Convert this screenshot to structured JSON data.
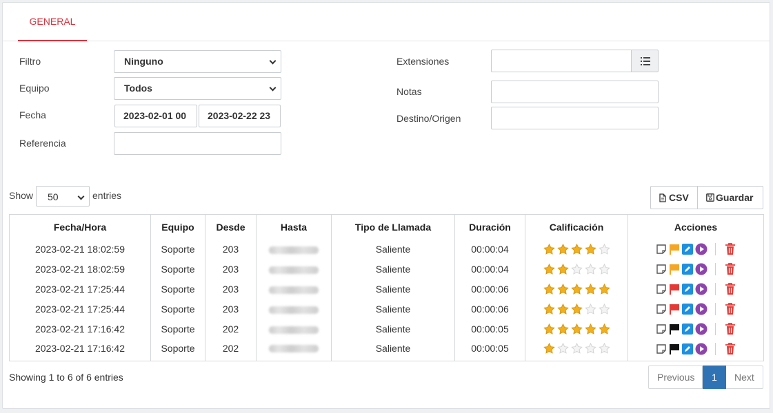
{
  "tabs": {
    "general": "GENERAL"
  },
  "filters": {
    "filtro_label": "Filtro",
    "filtro_value": "Ninguno",
    "equipo_label": "Equipo",
    "equipo_value": "Todos",
    "fecha_label": "Fecha",
    "fecha_desde": "2023-02-01 00",
    "fecha_hasta": "2023-02-22 23",
    "referencia_label": "Referencia",
    "referencia_value": "",
    "extensiones_label": "Extensiones",
    "extensiones_value": "",
    "notas_label": "Notas",
    "notas_value": "",
    "destino_label": "Destino/Origen",
    "destino_value": ""
  },
  "length": {
    "show": "Show",
    "value": "50",
    "entries": "entries"
  },
  "buttons": {
    "csv": "CSV",
    "guardar": "Guardar"
  },
  "table": {
    "headers": [
      "Fecha/Hora",
      "Equipo",
      "Desde",
      "Hasta",
      "Tipo de Llamada",
      "Duración",
      "Calificación",
      "Acciones"
    ],
    "rows": [
      {
        "fecha": "2023-02-21 18:02:59",
        "equipo": "Soporte",
        "desde": "203",
        "tipo": "Saliente",
        "duracion": "00:00:04",
        "rating": 4,
        "flag": "orange"
      },
      {
        "fecha": "2023-02-21 18:02:59",
        "equipo": "Soporte",
        "desde": "203",
        "tipo": "Saliente",
        "duracion": "00:00:04",
        "rating": 2,
        "flag": "orange"
      },
      {
        "fecha": "2023-02-21 17:25:44",
        "equipo": "Soporte",
        "desde": "203",
        "tipo": "Saliente",
        "duracion": "00:00:06",
        "rating": 5,
        "flag": "red"
      },
      {
        "fecha": "2023-02-21 17:25:44",
        "equipo": "Soporte",
        "desde": "203",
        "tipo": "Saliente",
        "duracion": "00:00:06",
        "rating": 3,
        "flag": "red"
      },
      {
        "fecha": "2023-02-21 17:16:42",
        "equipo": "Soporte",
        "desde": "202",
        "tipo": "Saliente",
        "duracion": "00:00:05",
        "rating": 5,
        "flag": "black"
      },
      {
        "fecha": "2023-02-21 17:16:42",
        "equipo": "Soporte",
        "desde": "202",
        "tipo": "Saliente",
        "duracion": "00:00:05",
        "rating": 1,
        "flag": "black"
      }
    ]
  },
  "footer": {
    "info": "Showing 1 to 6 of 6 entries",
    "previous": "Previous",
    "page": "1",
    "next": "Next"
  },
  "colors": {
    "accent": "#e0303b",
    "star_on": "#f2b01e",
    "star_off": "#d4d4d4",
    "flag_orange": "#f5a623",
    "flag_red": "#e53935",
    "flag_black": "#111111",
    "edit": "#1e90e0",
    "play": "#8e44ad",
    "delete": "#e53935",
    "pager_active": "#2f73b5"
  },
  "icons": {
    "extensiones_addon": "list-icon",
    "csv": "file-icon",
    "guardar": "save-icon",
    "acciones": [
      "note-icon",
      "flag-icon",
      "edit-icon",
      "play-icon",
      "trash-icon"
    ]
  }
}
